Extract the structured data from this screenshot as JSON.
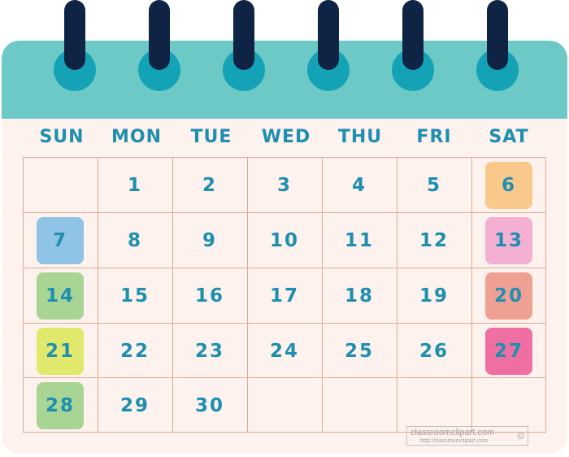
{
  "calendar": {
    "weekdays": [
      "SUN",
      "MON",
      "TUE",
      "WED",
      "THU",
      "FRI",
      "SAT"
    ],
    "weeks": [
      [
        "",
        "1",
        "2",
        "3",
        "4",
        "5",
        "6"
      ],
      [
        "7",
        "8",
        "9",
        "10",
        "11",
        "12",
        "13"
      ],
      [
        "14",
        "15",
        "16",
        "17",
        "18",
        "19",
        "20"
      ],
      [
        "21",
        "22",
        "23",
        "24",
        "25",
        "26",
        "27"
      ],
      [
        "28",
        "29",
        "30",
        "",
        "",
        "",
        ""
      ]
    ],
    "highlighted_days": [
      {
        "day": "6",
        "color": "#f9c98b"
      },
      {
        "day": "7",
        "color": "#8fc4e6"
      },
      {
        "day": "13",
        "color": "#f4b0d2"
      },
      {
        "day": "14",
        "color": "#a9d594"
      },
      {
        "day": "20",
        "color": "#f09f93"
      },
      {
        "day": "21",
        "color": "#e0e96b"
      },
      {
        "day": "27",
        "color": "#ef6fa3"
      },
      {
        "day": "28",
        "color": "#a9d594"
      }
    ],
    "colors": {
      "header_band": "#6cc9c6",
      "ring_post": "#0f2345",
      "ring_hole": "#14a3b6",
      "panel": "#fdf2ee",
      "grid_line": "#e4a892",
      "text": "#1e8fb0"
    },
    "binding_ring_icon": "binder-ring-icon"
  },
  "watermark": {
    "site": "classroomclipart.com",
    "url": "http://classroomclipart.com",
    "icon": "©"
  }
}
